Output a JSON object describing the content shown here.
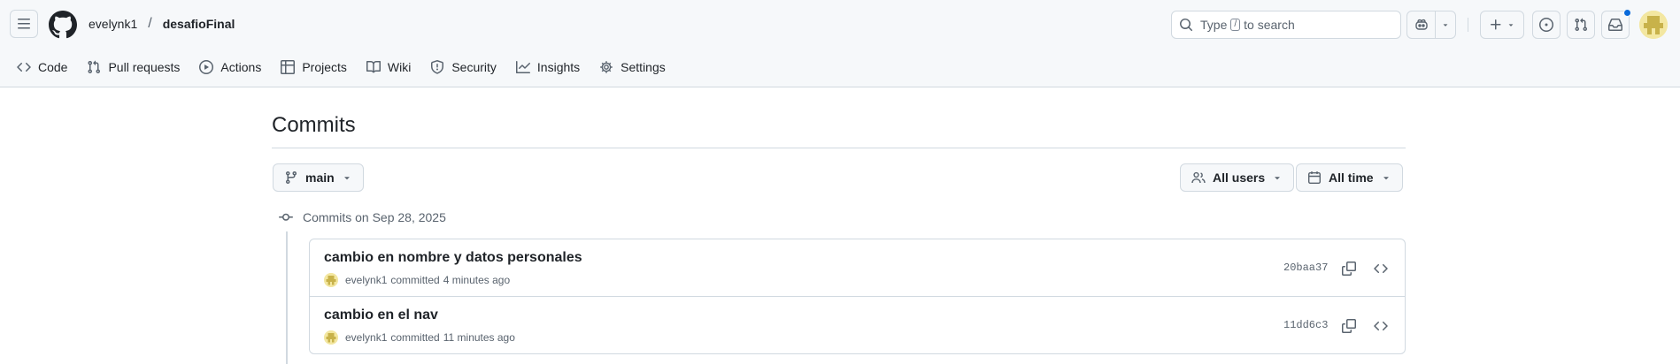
{
  "header": {
    "owner": "evelynk1",
    "separator": "/",
    "repo": "desafioFinal",
    "search": {
      "prefix": "Type",
      "key": "/",
      "suffix": "to search"
    }
  },
  "nav": [
    {
      "label": "Code",
      "icon": "code-icon"
    },
    {
      "label": "Pull requests",
      "icon": "pull-request-icon"
    },
    {
      "label": "Actions",
      "icon": "play-icon"
    },
    {
      "label": "Projects",
      "icon": "table-icon"
    },
    {
      "label": "Wiki",
      "icon": "book-icon"
    },
    {
      "label": "Security",
      "icon": "shield-icon"
    },
    {
      "label": "Insights",
      "icon": "graph-icon"
    },
    {
      "label": "Settings",
      "icon": "gear-icon"
    }
  ],
  "page": {
    "title": "Commits",
    "branch": "main",
    "users_filter": "All users",
    "time_filter": "All time"
  },
  "groups": [
    {
      "heading": "Commits on Sep 28, 2025",
      "commits": [
        {
          "message": "cambio en nombre y datos personales",
          "author": "evelynk1",
          "action": "committed",
          "time": "4 minutes ago",
          "sha": "20baa37"
        },
        {
          "message": "cambio en el nav",
          "author": "evelynk1",
          "action": "committed",
          "time": "11 minutes ago",
          "sha": "11dd6c3"
        }
      ]
    }
  ],
  "colors": {
    "accent": "#0969da",
    "border": "#d1d9e0",
    "muted": "#59636e",
    "header_bg": "#f6f8fa",
    "avatar": "#f3e7a1"
  }
}
